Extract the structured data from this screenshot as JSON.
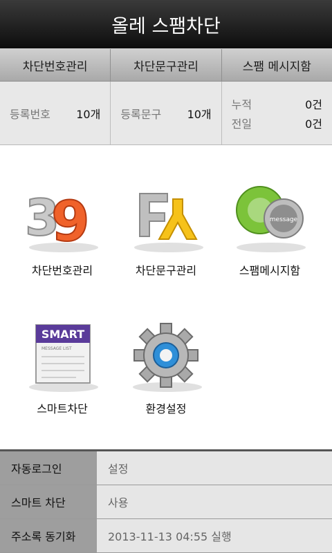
{
  "app": {
    "title": "올레 스팸차단"
  },
  "tabs": [
    {
      "label": "차단번호관리"
    },
    {
      "label": "차단문구관리"
    },
    {
      "label": "스팸 메시지함"
    }
  ],
  "stats": {
    "registered_numbers": {
      "label": "등록번호",
      "value": "10개"
    },
    "registered_phrases": {
      "label": "등록문구",
      "value": "10개"
    },
    "spam_total": {
      "label": "누적",
      "value": "0건"
    },
    "spam_yesterday": {
      "label": "전일",
      "value": "0건"
    }
  },
  "menu": [
    {
      "label": "차단번호관리",
      "icon": "number-39-icon"
    },
    {
      "label": "차단문구관리",
      "icon": "letters-icon"
    },
    {
      "label": "스팸메시지함",
      "icon": "message-bubbles-icon"
    },
    {
      "label": "스마트차단",
      "icon": "smart-list-icon"
    },
    {
      "label": "환경설정",
      "icon": "gear-icon"
    }
  ],
  "settings": [
    {
      "key": "자동로그인",
      "value": "설정"
    },
    {
      "key": "스마트 차단",
      "value": "사용"
    },
    {
      "key": "주소록 동기화",
      "value": "2013-11-13 04:55 실행"
    }
  ],
  "colors": {
    "title_bar": "#1f1f1f",
    "accent_orange": "#f0622a",
    "accent_green": "#7cc33a",
    "accent_purple": "#5a3b9a"
  }
}
